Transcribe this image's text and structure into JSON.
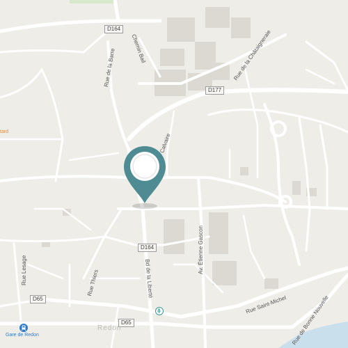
{
  "map": {
    "shields": {
      "d164_top": "D164",
      "d177": "D177",
      "d164_center": "D164",
      "d65_left": "D65",
      "d65_bottom": "D65"
    },
    "streets": {
      "chemin_bail": "Chemin Bail",
      "rue_chataigneraie": "Rue de la Châtaigneraie",
      "rue_barre": "Rue de la Barre",
      "calvaire": "Calvaire",
      "av_etienne_gascon": "Av. Étienne Gascon",
      "bd_liberte": "Bd de la Liberté",
      "rue_thiers": "Rue Thiers",
      "rue_lesage": "Rue Lesage",
      "rue_saint_michel": "Rue Saint-Michel",
      "bonne_nouvelle": "Rue de Bonne Nouvelle"
    },
    "pois": {
      "tard": "tard",
      "gare": "Gare de Redon"
    },
    "place_label": "Redon",
    "colors": {
      "land": "#efede8",
      "road": "#ffffff",
      "building": "#dcd9d2",
      "water": "#c9dfec",
      "park": "#d8e8cd",
      "marker": "#4e8b92",
      "station": "#2f7ac9",
      "poi_orange": "#e08a3c",
      "poi_teal": "#3a9a95"
    },
    "marker_icon": "location-pin-icon"
  }
}
